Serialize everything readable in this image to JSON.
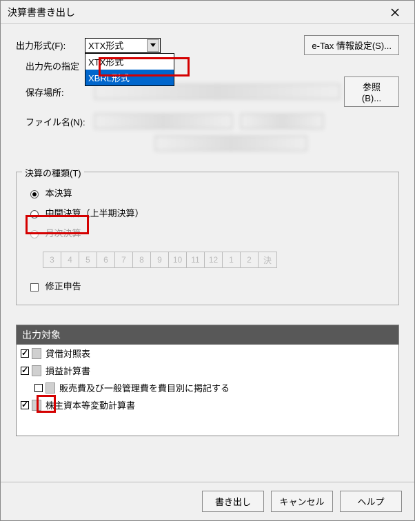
{
  "title": "決算書書き出し",
  "output_format": {
    "label": "出力形式(F):",
    "value": "XTX形式",
    "options": [
      "XTX形式",
      "XBRL形式"
    ],
    "selected_option": "XBRL形式"
  },
  "etax_button": "e-Tax 情報設定(S)...",
  "dest_label": "出力先の指定",
  "save_location_label": "保存場所:",
  "browse_button": "参照(B)...",
  "filename_label": "ファイル名(N):",
  "kessan_type": {
    "legend": "決算の種類(T)",
    "main": "本決算",
    "mid": "中間決算（上半期決算）",
    "monthly": "月次決算",
    "months": [
      "3",
      "4",
      "5",
      "6",
      "7",
      "8",
      "9",
      "10",
      "11",
      "12",
      "1",
      "2",
      "決"
    ],
    "amend": "修正申告"
  },
  "output_target": {
    "header": "出力対象",
    "items": [
      {
        "label": "貸借対照表",
        "checked": true,
        "indent": false
      },
      {
        "label": "損益計算書",
        "checked": true,
        "indent": false
      },
      {
        "label": "販売費及び一般管理費を費目別に掲記する",
        "checked": false,
        "indent": true
      },
      {
        "label": "株主資本等変動計算書",
        "checked": true,
        "indent": false
      }
    ]
  },
  "footer": {
    "export": "書き出し",
    "cancel": "キャンセル",
    "help": "ヘルプ"
  }
}
